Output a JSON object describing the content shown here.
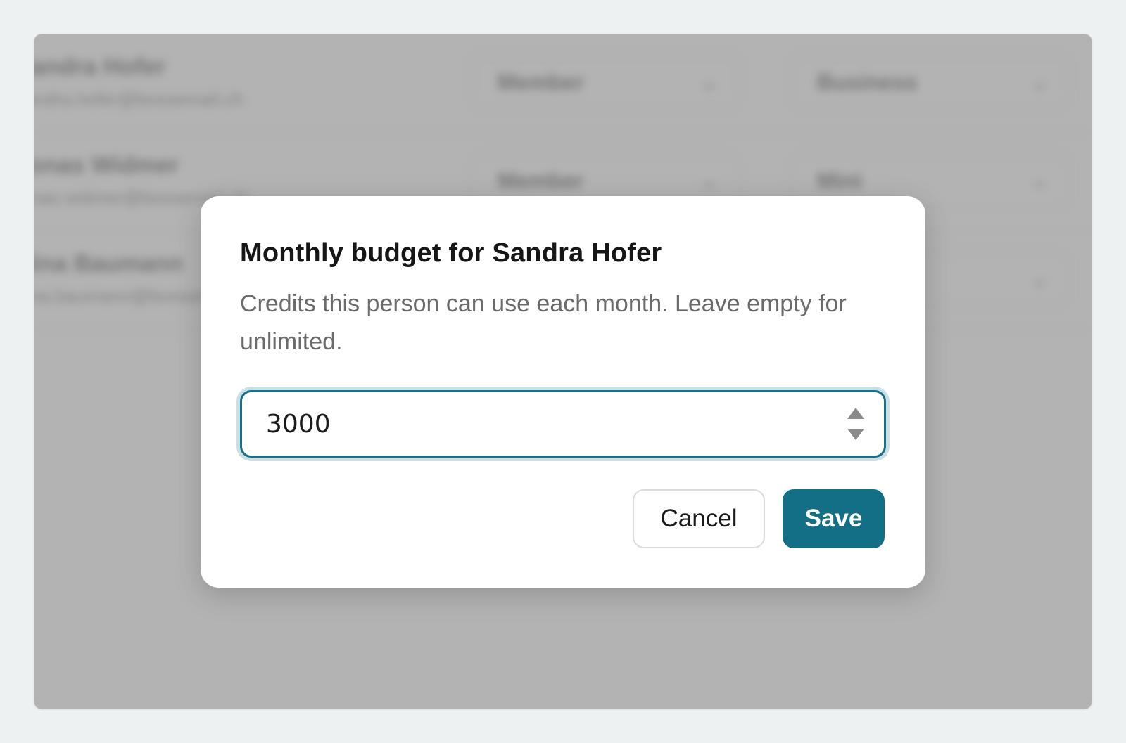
{
  "background": {
    "rows": [
      {
        "name": "Sandra Hofer",
        "email": "sandra.hofer@bossemail.ch",
        "role": "Member",
        "plan": "Business"
      },
      {
        "name": "Jonas Widmer",
        "email": "jonas.widmer@bossemail.ch",
        "role": "Member",
        "plan": "Mini"
      },
      {
        "name": "Nina Baumann",
        "email": "nina.baumann@bossemail.ch",
        "role": "",
        "plan": ""
      }
    ]
  },
  "dialog": {
    "title": "Monthly budget for Sandra Hofer",
    "description": "Credits this person can use each month. Leave empty for unlimited.",
    "budget_value": "3000",
    "cancel_label": "Cancel",
    "save_label": "Save"
  },
  "colors": {
    "accent": "#136f86",
    "overlay": "#b3b3b3"
  }
}
